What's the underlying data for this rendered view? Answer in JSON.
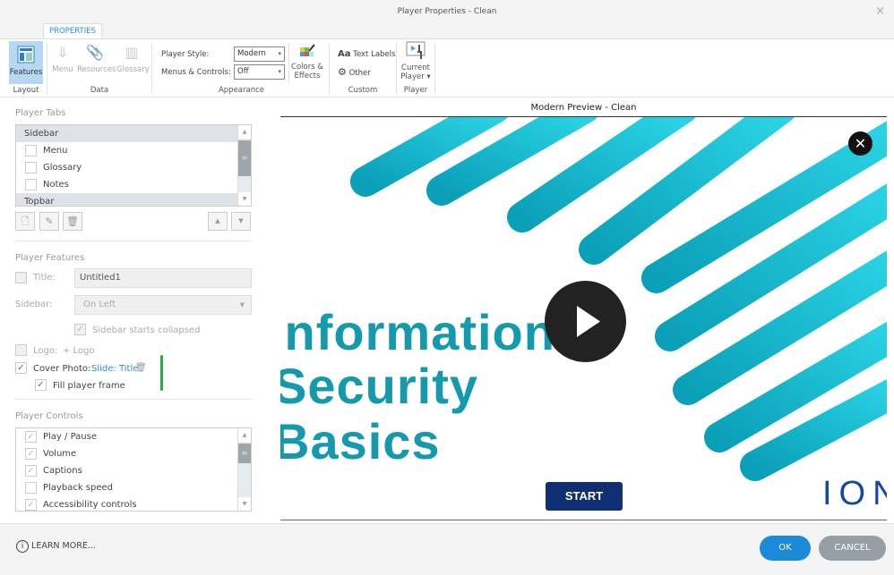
{
  "window": {
    "title": "Player Properties - Clean",
    "close": "×"
  },
  "ribbon": {
    "tab": "PROPERTIES",
    "buttons": {
      "features": "Features",
      "menu": "Menu",
      "resources": "Resources",
      "glossary": "Glossary",
      "colors_line1": "Colors &",
      "colors_line2": "Effects",
      "text_labels": "Text Labels",
      "text_labels_prefix": "Aa",
      "other": "Other",
      "current_player_line1": "Current",
      "current_player_line2": "Player ▾"
    },
    "groups": {
      "layout": "Layout",
      "data": "Data",
      "appearance": "Appearance",
      "custom": "Custom",
      "player": "Player"
    },
    "player_style_label": "Player Style:",
    "player_style_value": "Modern",
    "menus_controls_label": "Menus & Controls:",
    "menus_controls_value": "Off"
  },
  "player_tabs": {
    "heading": "Player Tabs",
    "groups": [
      "Sidebar",
      "Topbar"
    ],
    "items": [
      {
        "label": "Menu",
        "checked": false
      },
      {
        "label": "Glossary",
        "checked": false
      },
      {
        "label": "Notes",
        "checked": false
      }
    ]
  },
  "player_features": {
    "heading": "Player Features",
    "title_label": "Title:",
    "title_value": "Untitled1",
    "sidebar_label": "Sidebar:",
    "sidebar_value": "On Left",
    "sidebar_collapsed": "Sidebar starts collapsed",
    "logo_label": "Logo:",
    "logo_add": "+ Logo",
    "cover_label": "Cover Photo:",
    "cover_value": "Slide: Title",
    "fill_frame": "Fill player frame"
  },
  "player_controls": {
    "heading": "Player Controls",
    "items": [
      {
        "label": "Play / Pause",
        "checked": true
      },
      {
        "label": "Volume",
        "checked": true
      },
      {
        "label": "Captions",
        "checked": true
      },
      {
        "label": "Playback speed",
        "checked": false
      },
      {
        "label": "Accessibility controls",
        "checked": true
      }
    ]
  },
  "preview": {
    "title": "Modern Preview - Clean",
    "line1": "Information",
    "line2": "Security",
    "line3": "Basics",
    "start": "START",
    "logo": "ION",
    "colors": {
      "cyan": "#19c6d6",
      "navy": "#0f2f72"
    }
  },
  "footer": {
    "learn_more": "LEARN MORE...",
    "ok": "OK",
    "cancel": "CANCEL"
  }
}
